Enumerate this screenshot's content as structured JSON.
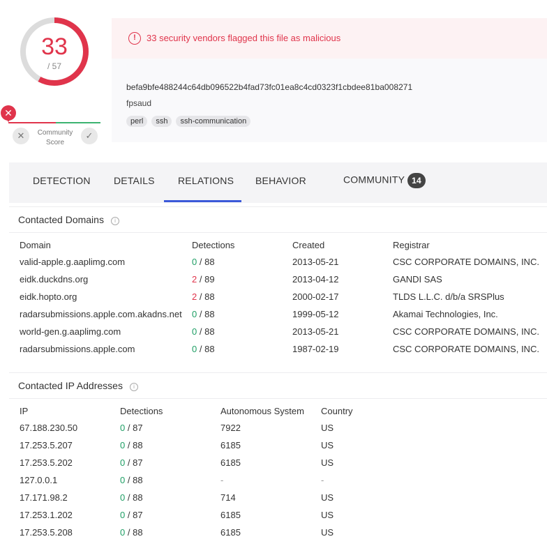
{
  "score": {
    "positives": "33",
    "total": "/ 57",
    "fraction": 0.579
  },
  "community": {
    "label_line1": "Community",
    "label_line2": "Score",
    "no_symbol": "✕",
    "yes_symbol": "✓",
    "marker_symbol": "✕"
  },
  "alert": {
    "icon": "!",
    "text": "33 security vendors flagged this file as malicious"
  },
  "file": {
    "hash": "befa9bfe488244c64db096522b4fad73fc01ea8c4cd0323f1cbdee81ba008271",
    "name": "fpsaud",
    "tags": [
      "perl",
      "ssh",
      "ssh-communication"
    ]
  },
  "tabs": {
    "detection": "DETECTION",
    "details": "DETAILS",
    "relations": "RELATIONS",
    "behavior": "BEHAVIOR",
    "community": "COMMUNITY",
    "community_count": "14"
  },
  "domains": {
    "title": "Contacted Domains",
    "headers": {
      "domain": "Domain",
      "detections": "Detections",
      "created": "Created",
      "registrar": "Registrar"
    },
    "rows": [
      {
        "domain": "valid-apple.g.aaplimg.com",
        "pos": "0",
        "total": "/ 88",
        "created": "2013-05-21",
        "registrar": "CSC CORPORATE DOMAINS, INC.",
        "flag": "g"
      },
      {
        "domain": "eidk.duckdns.org",
        "pos": "2",
        "total": "/ 89",
        "created": "2013-04-12",
        "registrar": "GANDI SAS",
        "flag": "r"
      },
      {
        "domain": "eidk.hopto.org",
        "pos": "2",
        "total": "/ 88",
        "created": "2000-02-17",
        "registrar": "TLDS L.L.C. d/b/a SRSPlus",
        "flag": "r"
      },
      {
        "domain": "radarsubmissions.apple.com.akadns.net",
        "pos": "0",
        "total": "/ 88",
        "created": "1999-05-12",
        "registrar": "Akamai Technologies, Inc.",
        "flag": "g"
      },
      {
        "domain": "world-gen.g.aaplimg.com",
        "pos": "0",
        "total": "/ 88",
        "created": "2013-05-21",
        "registrar": "CSC CORPORATE DOMAINS, INC.",
        "flag": "g"
      },
      {
        "domain": "radarsubmissions.apple.com",
        "pos": "0",
        "total": "/ 88",
        "created": "1987-02-19",
        "registrar": "CSC CORPORATE DOMAINS, INC.",
        "flag": "g"
      }
    ]
  },
  "ips": {
    "title": "Contacted IP Addresses",
    "headers": {
      "ip": "IP",
      "detections": "Detections",
      "asn": "Autonomous System",
      "country": "Country"
    },
    "rows": [
      {
        "ip": "67.188.230.50",
        "pos": "0",
        "total": "/ 87",
        "asn": "7922",
        "country": "US"
      },
      {
        "ip": "17.253.5.207",
        "pos": "0",
        "total": "/ 88",
        "asn": "6185",
        "country": "US"
      },
      {
        "ip": "17.253.5.202",
        "pos": "0",
        "total": "/ 87",
        "asn": "6185",
        "country": "US"
      },
      {
        "ip": "127.0.0.1",
        "pos": "0",
        "total": "/ 88",
        "asn": "-",
        "country": "-"
      },
      {
        "ip": "17.171.98.2",
        "pos": "0",
        "total": "/ 88",
        "asn": "714",
        "country": "US"
      },
      {
        "ip": "17.253.1.202",
        "pos": "0",
        "total": "/ 87",
        "asn": "6185",
        "country": "US"
      },
      {
        "ip": "17.253.5.208",
        "pos": "0",
        "total": "/ 88",
        "asn": "6185",
        "country": "US"
      }
    ]
  },
  "colors": {
    "malicious": "#e0344b",
    "clean": "#1e9e64",
    "tab_active": "#3b59d9"
  }
}
